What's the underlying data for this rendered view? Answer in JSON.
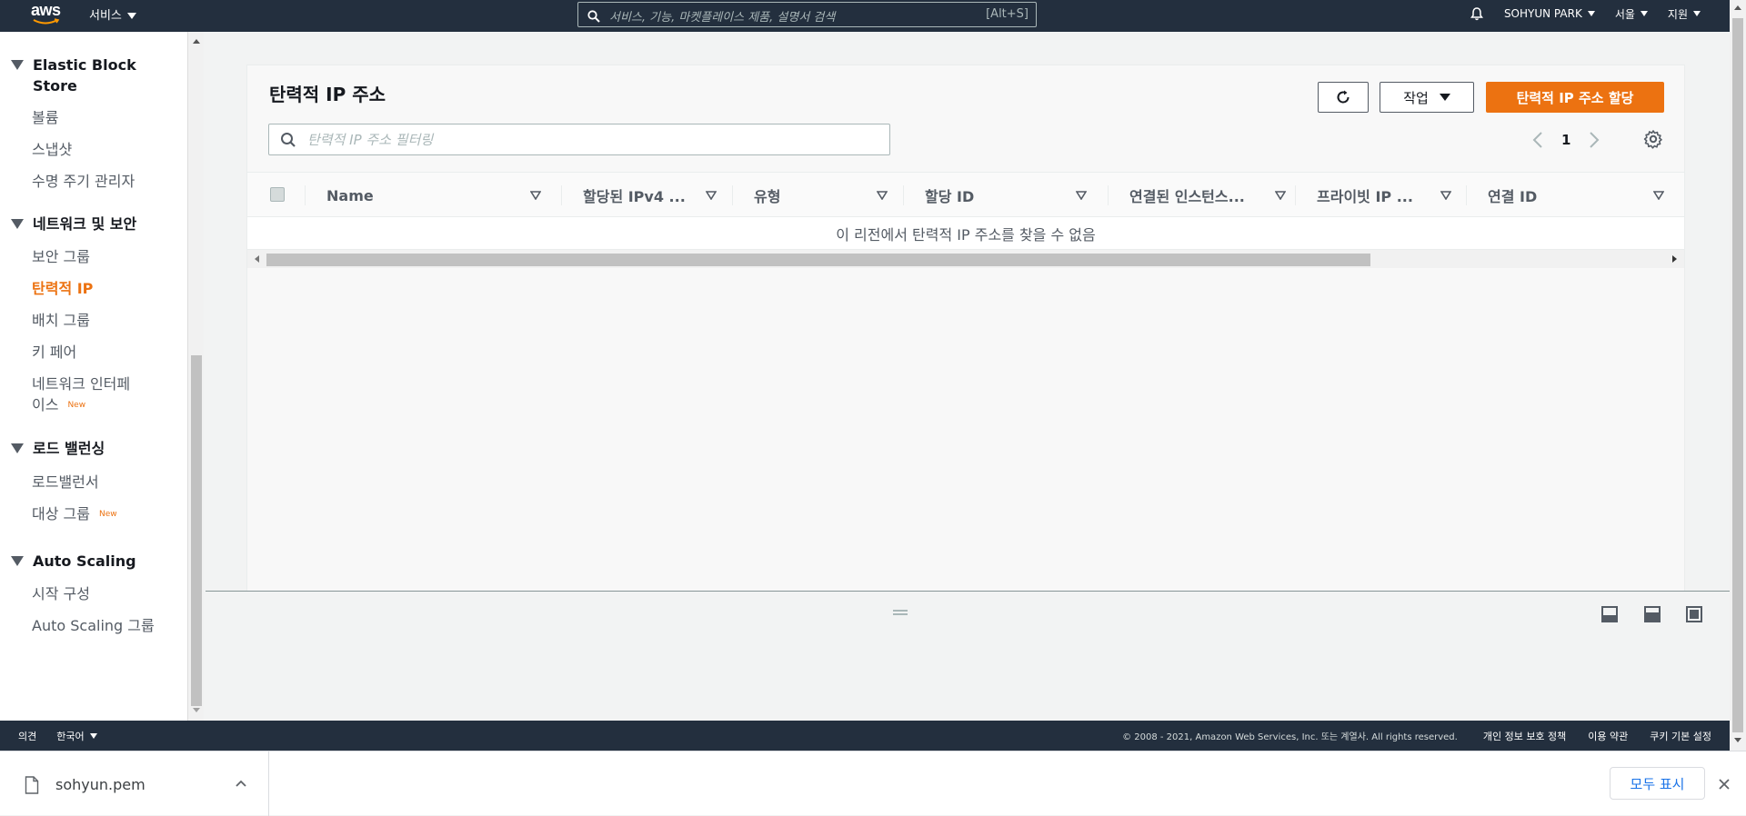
{
  "topnav": {
    "logo_text": "aws",
    "services_label": "서비스",
    "search_placeholder": "서비스, 기능, 마켓플레이스 제품, 설명서 검색",
    "search_shortcut": "[Alt+S]",
    "user_label": "SOHYUN PARK",
    "region_label": "서울",
    "support_label": "지원"
  },
  "sidebar": {
    "sections": [
      {
        "title": "Elastic Block Store",
        "items": [
          "볼륨",
          "스냅샷",
          "수명 주기 관리자"
        ]
      },
      {
        "title": "네트워크 및 보안",
        "items": [
          "보안 그룹",
          "탄력적 IP",
          "배치 그룹",
          "키 페어",
          "네트워크 인터페이스"
        ]
      },
      {
        "title": "로드 밸런싱",
        "items": [
          "로드밸런서",
          "대상 그룹"
        ]
      },
      {
        "title": "Auto Scaling",
        "items": [
          "시작 구성",
          "Auto Scaling 그룹"
        ]
      }
    ],
    "ebs_title_line1": "Elastic Block",
    "ebs_title_line2": "Store",
    "eni_line1": "네트워크 인터페",
    "eni_line2": "이스",
    "new_badge": "New",
    "active_item": "탄력적 IP"
  },
  "panel": {
    "title": "탄력적 IP 주소",
    "actions_label": "작업",
    "allocate_label": "탄력적 IP 주소 할당",
    "filter_placeholder": "탄력적 IP 주소 필터링",
    "page_number": "1",
    "columns": [
      "Name",
      "할당된 IPv4 ...",
      "유형",
      "할당 ID",
      "연결된 인스턴스...",
      "프라이빗 IP ...",
      "연결 ID"
    ],
    "empty_message": "이 리전에서 탄력적 IP 주소를 찾을 수 없음"
  },
  "footer": {
    "feedback": "의견",
    "language": "한국어",
    "copyright": "© 2008 - 2021, Amazon Web Services, Inc. 또는 계열사. All rights reserved.",
    "privacy": "개인 정보 보호 정책",
    "terms": "이용 약관",
    "cookies": "쿠키 기본 설정"
  },
  "download_bar": {
    "filename": "sohyun.pem",
    "show_all_label": "모두 표시"
  },
  "colors": {
    "nav_bg": "#232f3e",
    "accent_orange": "#ec7211",
    "link_blue": "#1a73e8"
  }
}
